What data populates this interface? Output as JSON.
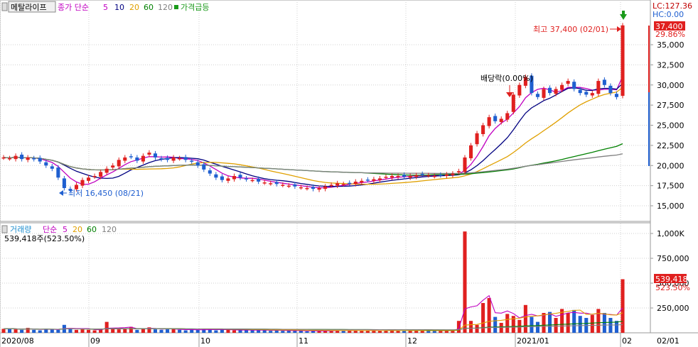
{
  "price_panel": {
    "stock_name": "메탈라이프",
    "ma_label": "종가 단순",
    "ma_periods": [
      "5",
      "10",
      "20",
      "60",
      "120"
    ],
    "ma_colors": [
      "#c000c0",
      "#000080",
      "#e0a000",
      "#008000",
      "#808080"
    ],
    "signal_label": "가격급등",
    "lc_label": "LC:127.36",
    "hc_label": "HC:0.00",
    "high_note": "최고 37,400 (02/01)",
    "low_note": "최저 16,450 (08/21)",
    "dividend_note": "배당락(0.00%)",
    "current_price": "37,400",
    "change_pct": "29.86%",
    "y_ticks": [
      "35,000",
      "32,500",
      "30,000",
      "27,500",
      "25,000",
      "22,500",
      "20,000",
      "17,500",
      "15,000"
    ]
  },
  "volume_panel": {
    "label": "거래량",
    "ma_label": "단순",
    "ma_periods": [
      "5",
      "20",
      "60",
      "120"
    ],
    "summary": "539,418주(523.50%)",
    "current_volume": "539,418",
    "current_pct": "523.50%",
    "y_ticks": [
      "1,000K",
      "750,000",
      "500,000",
      "250,000"
    ]
  },
  "x_axis": {
    "labels": [
      "2020/08",
      "09",
      "10",
      "11",
      "12",
      "2021/01",
      "02",
      "02/01"
    ]
  },
  "colors": {
    "up": "#e0201f",
    "down": "#1f5fd0",
    "grid": "#c8c8c8"
  },
  "chart_data": {
    "type": "candlestick",
    "series_price": {
      "ylim": [
        13500,
        39000
      ],
      "values_close": [
        21000,
        20900,
        21200,
        20800,
        21000,
        20800,
        20500,
        20000,
        19600,
        18500,
        17200,
        16900,
        17600,
        18200,
        18500,
        18700,
        19200,
        19600,
        20000,
        20700,
        21000,
        21100,
        20600,
        21200,
        21600,
        21000,
        20800,
        20700,
        21000,
        20900,
        20700,
        20500,
        20000,
        19500,
        19000,
        18500,
        18200,
        18400,
        18700,
        18500,
        18300,
        18200,
        18000,
        17900,
        17800,
        17700,
        17600,
        17500,
        17400,
        17300,
        17200,
        17100,
        17200,
        17400,
        17600,
        17800,
        17700,
        17800,
        18000,
        18100,
        18200,
        18300,
        18400,
        18600,
        18700,
        18700,
        18600,
        18700,
        18800,
        18900,
        18800,
        18700,
        18800,
        18900,
        19000,
        19300,
        21000,
        22500,
        24000,
        25000,
        26000,
        25500,
        25800,
        26500,
        28800,
        30000,
        31000,
        29000,
        28500,
        29500,
        29000,
        29500,
        30000,
        30500,
        29500,
        29000,
        28800,
        29000,
        30500,
        30000,
        29000,
        28500,
        37400
      ],
      "values_volume": [
        40000,
        45000,
        35000,
        30000,
        50000,
        30000,
        25000,
        40000,
        35000,
        30000,
        80000,
        40000,
        30000,
        35000,
        30000,
        25000,
        30000,
        110000,
        45000,
        35000,
        40000,
        60000,
        30000,
        40000,
        55000,
        35000,
        30000,
        35000,
        40000,
        30000,
        25000,
        30000,
        30000,
        40000,
        35000,
        25000,
        35000,
        30000,
        25000,
        25000,
        30000,
        25000,
        30000,
        25000,
        20000,
        25000,
        20000,
        25000,
        20000,
        20000,
        15000,
        20000,
        18000,
        25000,
        20000,
        25000,
        20000,
        25000,
        22000,
        20000,
        25000,
        25000,
        20000,
        22000,
        25000,
        20000,
        20000,
        25000,
        22000,
        25000,
        20000,
        18000,
        20000,
        25000,
        20000,
        120000,
        1020000,
        120000,
        80000,
        300000,
        350000,
        160000,
        100000,
        190000,
        170000,
        130000,
        280000,
        160000,
        110000,
        200000,
        210000,
        150000,
        240000,
        200000,
        230000,
        170000,
        150000,
        180000,
        240000,
        200000,
        150000,
        120000,
        539418
      ]
    }
  }
}
